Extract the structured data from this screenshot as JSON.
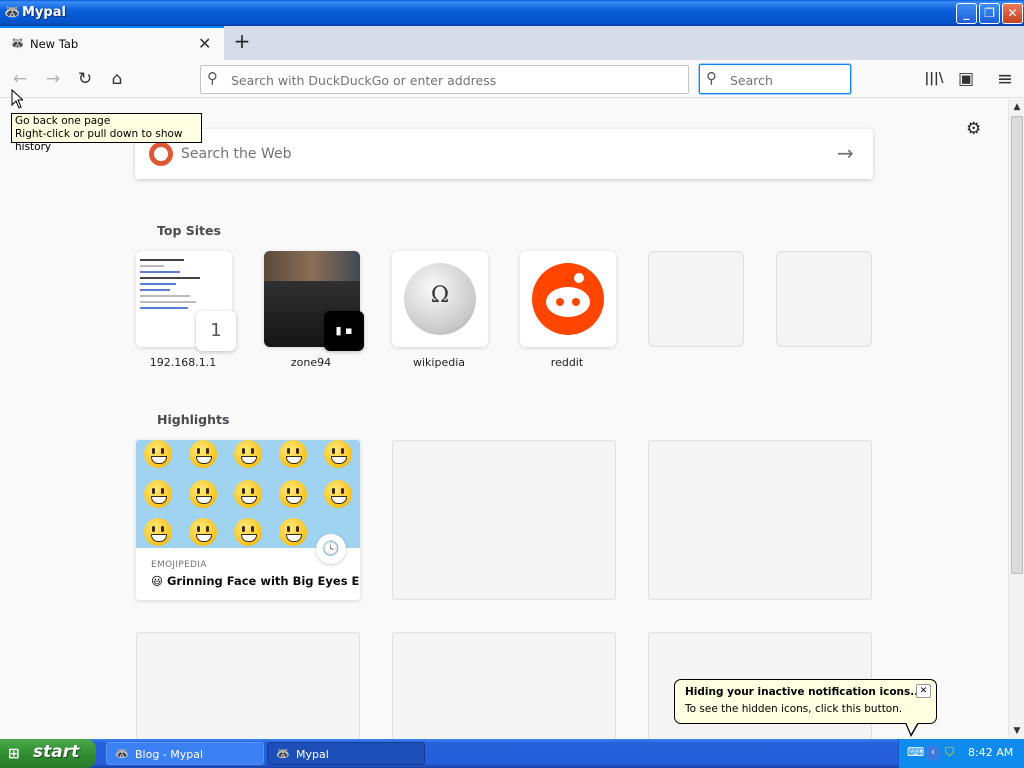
{
  "window": {
    "title": "Mypal",
    "minimize": "_",
    "maximize": "❐",
    "close": "✕"
  },
  "tabs": [
    {
      "label": "New Tab",
      "close": "✕"
    }
  ],
  "newtab_label": "+",
  "toolbar": {
    "back": "←",
    "forward": "→",
    "reload": "↻",
    "home": "⌂",
    "url_placeholder": "Search with DuckDuckGo or enter address",
    "url_value": "",
    "search_placeholder": "Search",
    "search_value": "",
    "library": "|||\\",
    "sidebar": "▣",
    "menu": "≡"
  },
  "tooltip": {
    "line1": "Go back one page",
    "line2": "Right-click or pull down to show history"
  },
  "newtab": {
    "settings_icon": "⚙",
    "websearch_placeholder": "Search the Web",
    "websearch_arrow": "→",
    "top_sites_title": "Top Sites",
    "top_sites": [
      {
        "label": "192.168.1.1",
        "badge": "1"
      },
      {
        "label": "zone94"
      },
      {
        "label": "wikipedia",
        "glyph": "Ω"
      },
      {
        "label": "reddit"
      },
      {
        "label": ""
      },
      {
        "label": ""
      }
    ],
    "highlights_title": "Highlights",
    "highlights": [
      {
        "source": "EMOJIPEDIA",
        "title": "😃 Grinning Face with Big Eyes E...",
        "clock": "🕓"
      }
    ]
  },
  "notification": {
    "title": "Hiding your inactive notification icons...",
    "text": "To see the hidden icons, click this button.",
    "close": "✕"
  },
  "taskbar": {
    "start": "start",
    "items": [
      {
        "label": "Blog - Mypal",
        "active": false
      },
      {
        "label": "Mypal",
        "active": true
      }
    ],
    "time": "8:42 AM"
  },
  "colors": {
    "accent": "#0a84ff",
    "reddit": "#ff4500",
    "duckduckgo": "#de5833",
    "xp_blue": "#245edb",
    "xp_start_green": "#2f8a2f"
  }
}
